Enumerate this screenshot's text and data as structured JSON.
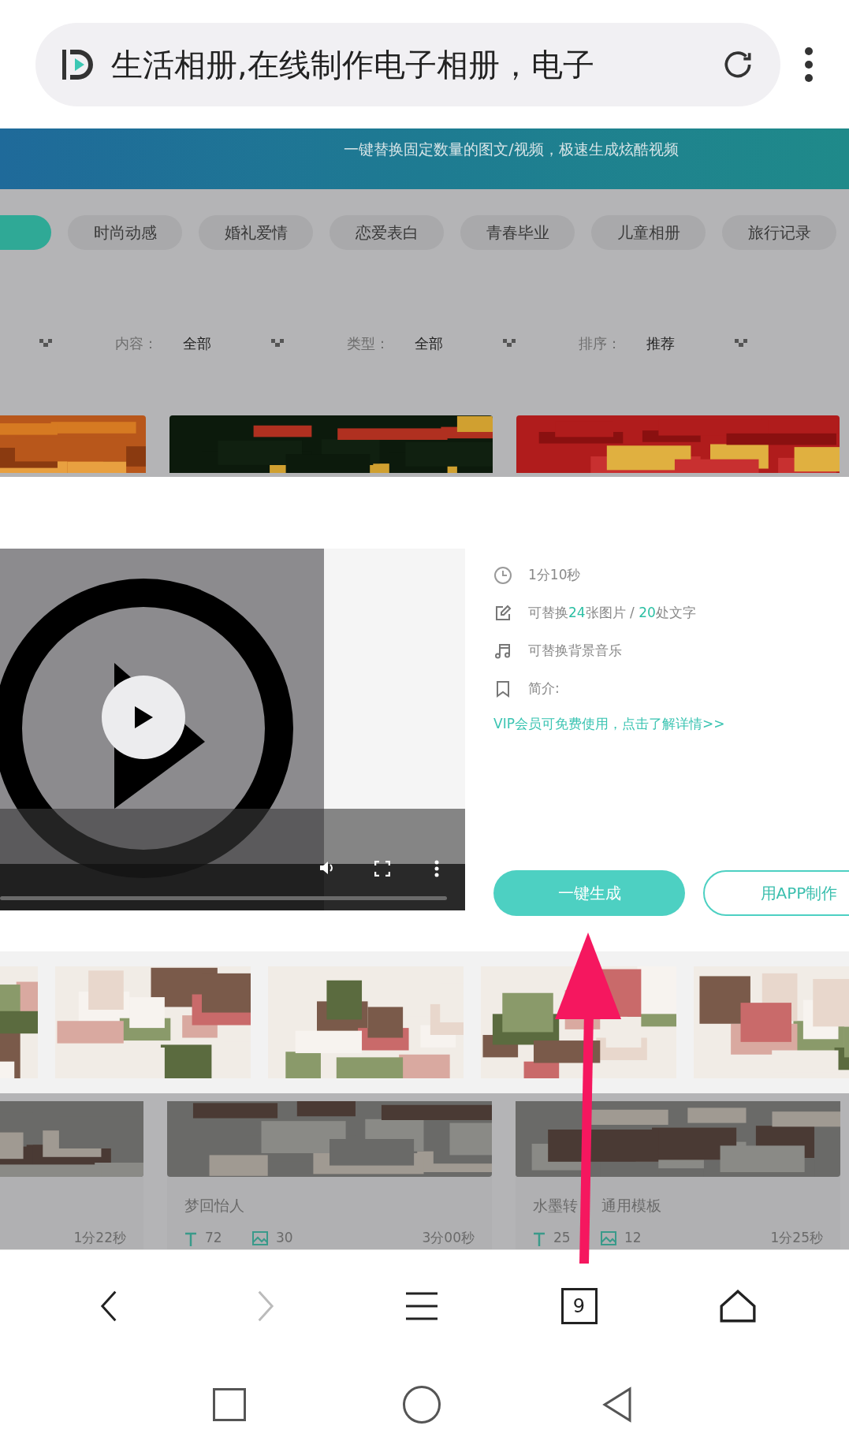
{
  "address_bar": {
    "title": "生活相册,在线制作电子相册，电子"
  },
  "banner": {
    "text": "一键替换固定数量的图文/视频，极速生成炫酷视频"
  },
  "categories": [
    {
      "selected": true
    },
    {
      "label": "时尚动感",
      "selected": false
    },
    {
      "label": "婚礼爱情",
      "selected": false
    },
    {
      "label": "恋爱表白",
      "selected": false
    },
    {
      "label": "青春毕业",
      "selected": false
    },
    {
      "label": "儿童相册",
      "selected": false
    },
    {
      "label": "旅行记录",
      "selected": false
    }
  ],
  "filters": [
    {
      "label": "内容：",
      "value": "全部"
    },
    {
      "label": "类型：",
      "value": "全部"
    },
    {
      "label": "排序：",
      "value": "推荐"
    }
  ],
  "detail": {
    "duration": "1分10秒",
    "replace_parts": [
      {
        "text": "可替换",
        "highlight": false
      },
      {
        "text": "24",
        "highlight": true
      },
      {
        "text": "张图片 / ",
        "highlight": false
      },
      {
        "text": "20",
        "highlight": true
      },
      {
        "text": "处文字",
        "highlight": false
      }
    ],
    "music": "可替换背景音乐",
    "intro": "简介:",
    "vip_link": "VIP会员可免费使用，点击了解详情>>",
    "buttons": [
      {
        "label": "一键生成",
        "kind": "primary"
      },
      {
        "label": "用APP制作",
        "kind": "outline"
      }
    ]
  },
  "cards": [
    {
      "duration": "1分22秒"
    },
    {
      "title": [
        "梦回怡人"
      ],
      "text_count": "72",
      "image_count": "30",
      "duration": "3分00秒"
    },
    {
      "title": [
        "水墨转",
        "通用模板"
      ],
      "text_count": "25",
      "image_count": "12",
      "duration": "1分25秒"
    }
  ],
  "browser_nav": {
    "back_enabled": true,
    "forward_enabled": false,
    "tab_count": "9"
  }
}
